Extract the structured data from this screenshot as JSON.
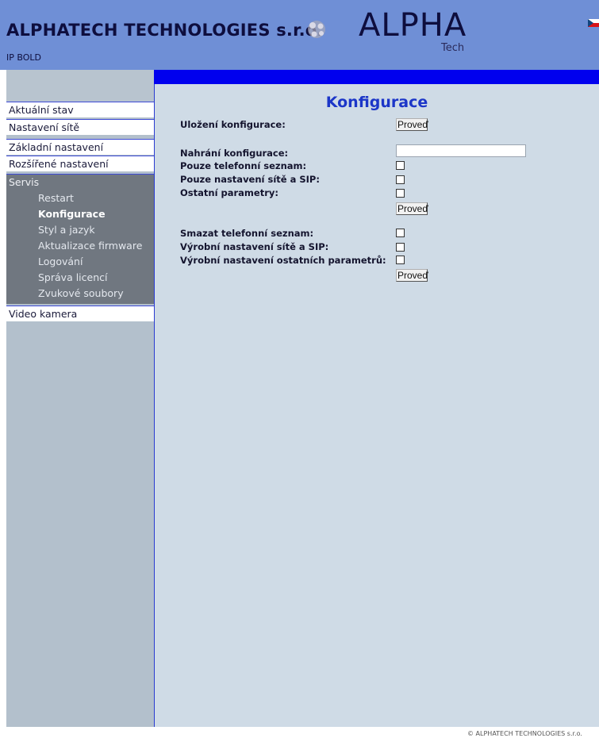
{
  "header": {
    "company": "ALPHATECH TECHNOLOGIES s.r.o.",
    "subtitle": "IP BOLD",
    "logo_text": "ALPHA",
    "logo_sub": "Tech"
  },
  "sidebar": {
    "items": [
      {
        "label": "Aktuální stav"
      },
      {
        "label": "Nastavení sítě"
      },
      {
        "label": "Základní nastavení"
      },
      {
        "label": "Rozšířené nastavení"
      }
    ],
    "servis": {
      "label": "Servis",
      "subitems": [
        {
          "label": "Restart"
        },
        {
          "label": "Konfigurace",
          "active": true
        },
        {
          "label": "Styl a jazyk"
        },
        {
          "label": "Aktualizace firmware"
        },
        {
          "label": "Logování"
        },
        {
          "label": "Správa licencí"
        },
        {
          "label": "Zvukové soubory"
        }
      ]
    },
    "video": {
      "label": "Video kamera"
    }
  },
  "main": {
    "title": "Konfigurace",
    "save": {
      "label": "Uložení konfigurace:",
      "button": "Proveď"
    },
    "upload": {
      "label": "Nahrání konfigurace:",
      "file_value": "",
      "options": [
        {
          "label": "Pouze telefonní seznam:",
          "checked": false
        },
        {
          "label": "Pouze nastavení sítě a SIP:",
          "checked": false
        },
        {
          "label": "Ostatní parametry:",
          "checked": false
        }
      ],
      "button": "Proveď"
    },
    "reset": {
      "options": [
        {
          "label": "Smazat telefonní seznam:",
          "checked": false
        },
        {
          "label": "Výrobní nastavení sítě a SIP:",
          "checked": false
        },
        {
          "label": "Výrobní nastavení ostatních parametrů:",
          "checked": false
        }
      ],
      "button": "Proveď"
    }
  },
  "footer": {
    "text": "© ALPHATECH TECHNOLOGIES s.r.o."
  },
  "colors": {
    "header_bg": "#6f8fd6",
    "content_bg": "#cfdbe6",
    "accent_blue": "#0000ee",
    "title_blue": "#1c36c8",
    "sidebar_bg": "#b3c0cc",
    "servis_bg": "#707780"
  }
}
